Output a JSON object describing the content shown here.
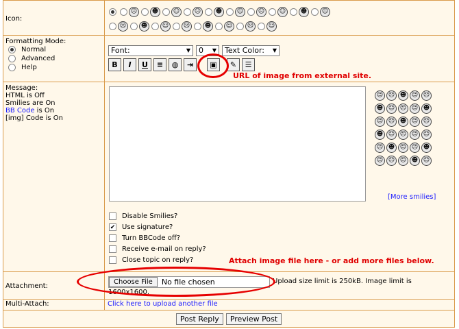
{
  "labels": {
    "icon": "Icon:",
    "formatting_mode": "Formatting Mode:",
    "message": "Message:",
    "attachment": "Attachment:",
    "multi_attach": "Multi-Attach:"
  },
  "formatting": {
    "options": [
      "Normal",
      "Advanced",
      "Help"
    ],
    "font_select": "Font:",
    "size_select": "0",
    "color_select": "Text Color:"
  },
  "message_info": {
    "html": "HTML is Off",
    "smilies": "Smilies are On",
    "bbcode_link": "BB Code",
    "bbcode_suffix": " is On",
    "img": "[img] Code is On"
  },
  "annotations": {
    "img_url": "URL of image from external site.",
    "attach": "Attach image file here - or add more files below."
  },
  "more_smilies": "[More smilies]",
  "checkboxes": [
    {
      "label": "Disable Smilies?",
      "checked": false
    },
    {
      "label": "Use signature?",
      "checked": true
    },
    {
      "label": "Turn BBCode off?",
      "checked": false
    },
    {
      "label": "Receive e-mail on reply?",
      "checked": false
    },
    {
      "label": "Close topic on reply?",
      "checked": false
    }
  ],
  "attachment": {
    "button": "Choose File",
    "status": "No file chosen",
    "limit_line1": "Upload size limit is 250kB. Image limit is",
    "limit_line2": "1600x1600."
  },
  "multi_attach_link": "Click here to upload another file",
  "buttons": {
    "post_reply": "Post Reply",
    "preview": "Preview Post"
  },
  "toolbar_glyphs": [
    "B",
    "I",
    "U",
    "≡",
    "◍",
    "⇥",
    "▣",
    "✎",
    "☰"
  ]
}
